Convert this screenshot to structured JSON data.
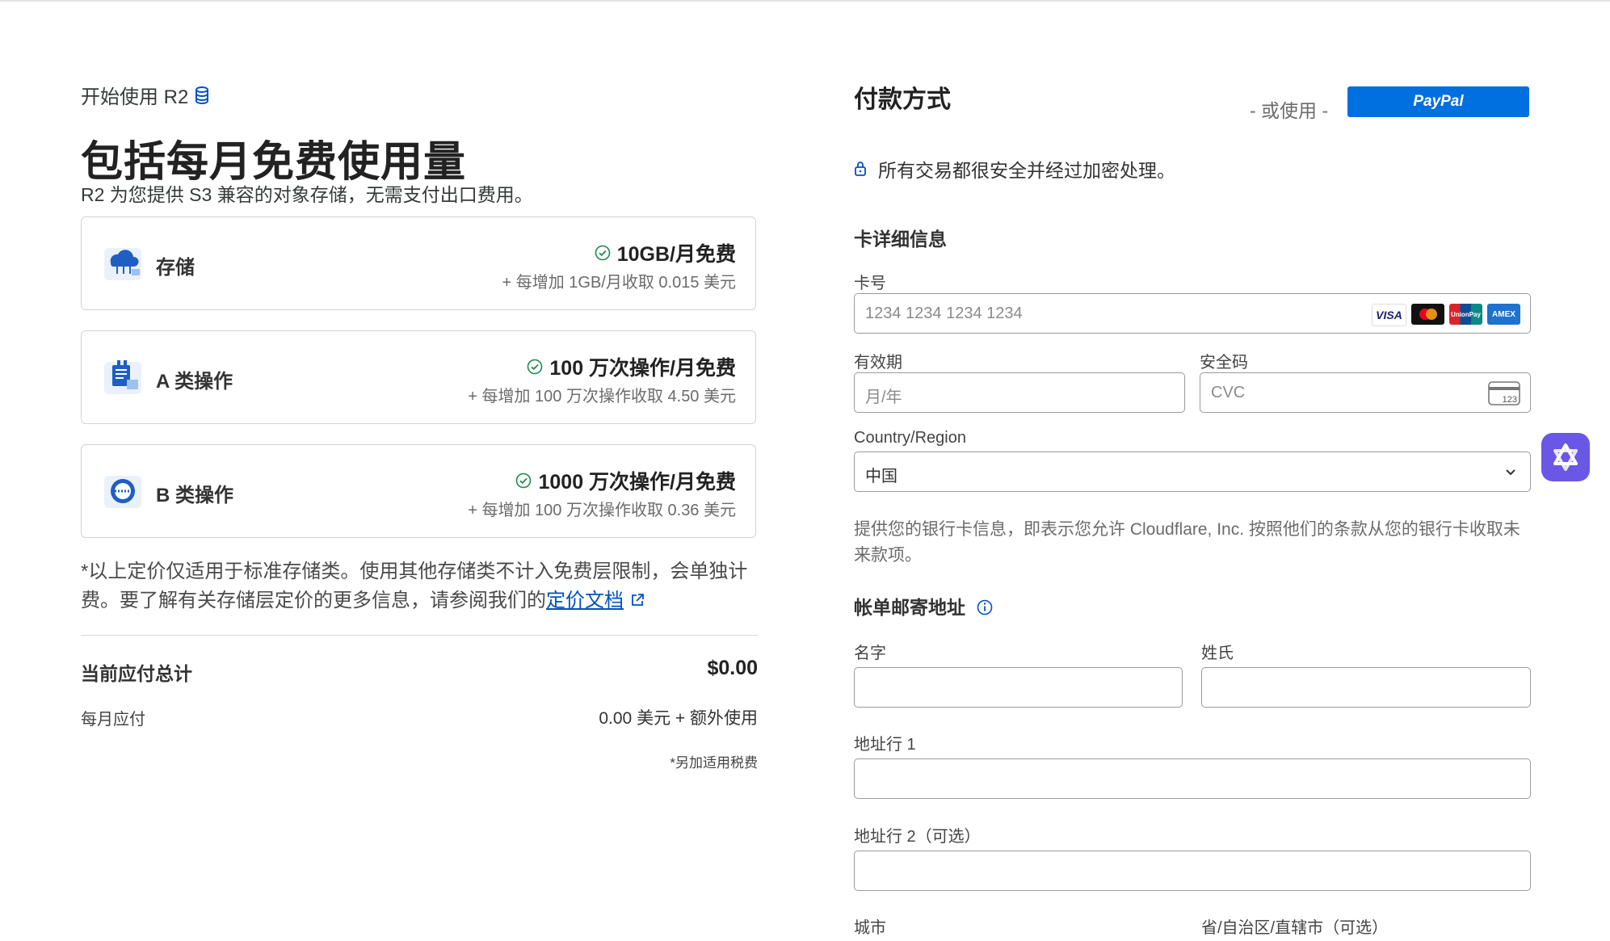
{
  "left": {
    "eyebrow": "开始使用 R2",
    "headline": "包括每月免费使用量",
    "subline": "R2 为您提供 S3 兼容的对象存储，无需支付出口费用。",
    "cards": [
      {
        "name": "存储",
        "free": "10GB/月免费",
        "extra": "+ 每增加 1GB/月收取 0.015 美元",
        "icon": "cloud-storage-icon"
      },
      {
        "name": "A 类操作",
        "free": "100 万次操作/月免费",
        "extra": "+ 每增加 100 万次操作收取 4.50 美元",
        "icon": "class-a-operations-icon"
      },
      {
        "name": "B 类操作",
        "free": "1000 万次操作/月免费",
        "extra": "+ 每增加 100 万次操作收取 0.36 美元",
        "icon": "class-b-operations-icon"
      }
    ],
    "note_text": "*以上定价仅适用于标准存储类。使用其他存储类不计入免费层限制，会单独计费。要了解有关存储层定价的更多信息，请参阅我们的",
    "note_link": "定价文档",
    "total_label": "当前应付总计",
    "total_value": "$0.00",
    "monthly_label": "每月应付",
    "monthly_value": "0.00 美元 + 额外使用",
    "tax_note": "*另加适用税费"
  },
  "right": {
    "title": "付款方式",
    "or_use": "- 或使用 -",
    "paypal_label": "PayPal",
    "secure_text": "所有交易都很安全并经过加密处理。",
    "card_section": "卡详细信息",
    "card_number_label": "卡号",
    "card_number_placeholder": "1234 1234 1234 1234",
    "card_brands": [
      "VISA",
      "Mastercard",
      "UnionPay",
      "AMEX"
    ],
    "expiry_label": "有效期",
    "expiry_placeholder": "月/年",
    "cvc_label": "安全码",
    "cvc_placeholder": "CVC",
    "cvc_icon_text": "123",
    "country_label": "Country/Region",
    "country_value": "中国",
    "consent": "提供您的银行卡信息，即表示您允许 Cloudflare, Inc. 按照他们的条款从您的银行卡收取未来款项。",
    "billing_section": "帐单邮寄地址",
    "first_name_label": "名字",
    "last_name_label": "姓氏",
    "address1_label": "地址行 1",
    "address2_label": "地址行 2（可选）",
    "city_label": "城市",
    "province_label": "省/自治区/直辖市（可选）"
  },
  "colors": {
    "link": "#0051c3",
    "paypal": "#0070e0",
    "check": "#1e8a4c",
    "assistant": "#6a57e6"
  }
}
